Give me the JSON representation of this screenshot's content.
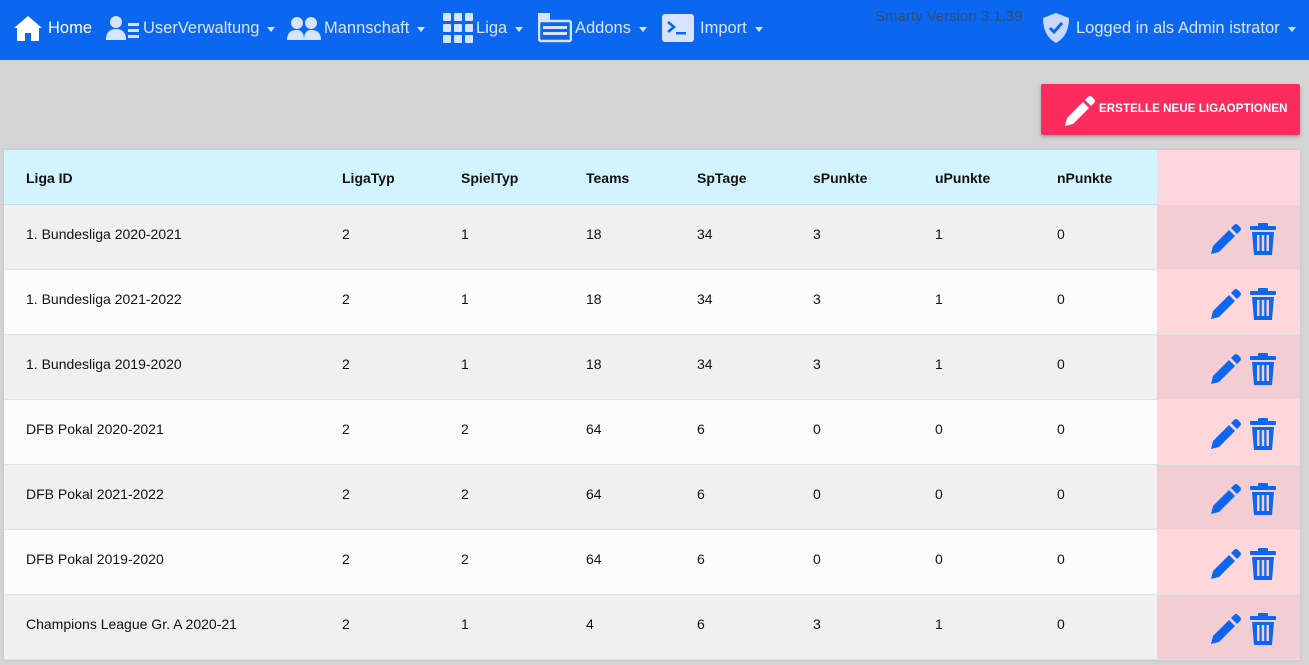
{
  "navbar": {
    "home": "Home",
    "items": [
      {
        "label": "UserVerwaltung",
        "icon": "users-list-icon"
      },
      {
        "label": "Mannschaft",
        "icon": "team-icon"
      },
      {
        "label": "Liga",
        "icon": "grid-icon"
      },
      {
        "label": "Addons",
        "icon": "addons-icon"
      },
      {
        "label": "Import",
        "icon": "terminal-icon"
      }
    ],
    "version": "Smarty Version 3.1.39",
    "user": "Logged in als Admin istrator"
  },
  "create_button": {
    "label": "ERSTELLE NEUE LIGAOPTIONEN"
  },
  "table": {
    "headers": [
      "Liga ID",
      "LigaTyp",
      "SpielTyp",
      "Teams",
      "SpTage",
      "sPunkte",
      "uPunkte",
      "nPunkte"
    ],
    "rows": [
      [
        "1. Bundesliga 2020-2021",
        "2",
        "1",
        "18",
        "34",
        "3",
        "1",
        "0"
      ],
      [
        "1. Bundesliga 2021-2022",
        "2",
        "1",
        "18",
        "34",
        "3",
        "1",
        "0"
      ],
      [
        "1. Bundesliga 2019-2020",
        "2",
        "1",
        "18",
        "34",
        "3",
        "1",
        "0"
      ],
      [
        "DFB Pokal 2020-2021",
        "2",
        "2",
        "64",
        "6",
        "0",
        "0",
        "0"
      ],
      [
        "DFB Pokal 2021-2022",
        "2",
        "2",
        "64",
        "6",
        "0",
        "0",
        "0"
      ],
      [
        "DFB Pokal 2019-2020",
        "2",
        "2",
        "64",
        "6",
        "0",
        "0",
        "0"
      ],
      [
        "Champions League Gr. A 2020-21",
        "2",
        "1",
        "4",
        "6",
        "3",
        "1",
        "0"
      ]
    ]
  },
  "colors": {
    "navbar": "#0b66f0",
    "create_button": "#fb2c5c",
    "header_row": "#d2f4fd",
    "actions_column": "#ffd6da",
    "action_icon": "#0b66f0"
  }
}
